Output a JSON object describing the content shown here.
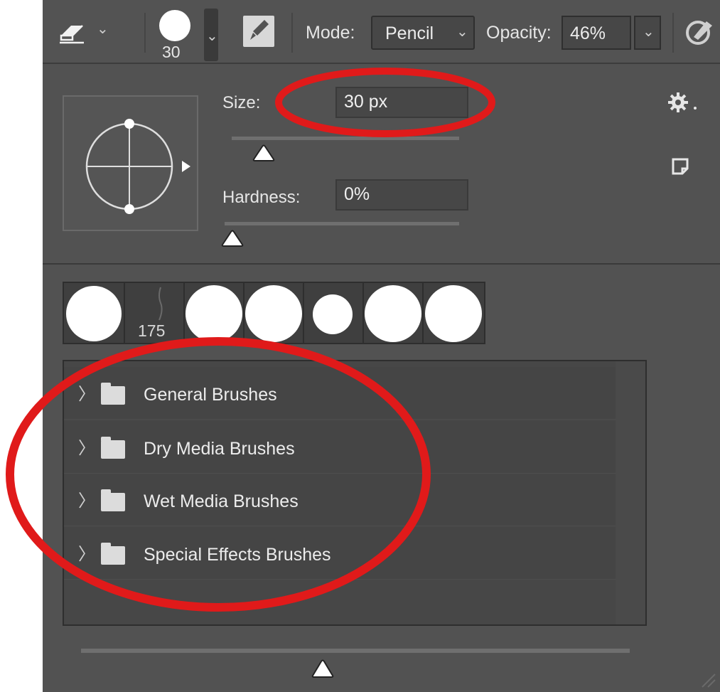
{
  "toolbar": {
    "tool_icon": "eraser-icon",
    "brush_size": "30",
    "mode_label": "Mode:",
    "mode_value": "Pencil",
    "opacity_label": "Opacity:",
    "opacity_value": "46%",
    "airbrush_icon": "airbrush-icon"
  },
  "brush_options": {
    "size_label": "Size:",
    "size_value": "30 px",
    "hardness_label": "Hardness:",
    "hardness_value": "0%",
    "size_slider_level_percent": 14,
    "hardness_slider_level_percent": 0,
    "gear_icon": "gear-icon",
    "new_preset_icon": "new-preset-icon"
  },
  "presets": {
    "items": [
      {
        "label": ""
      },
      {
        "label": "175"
      },
      {
        "label": ""
      },
      {
        "label": ""
      },
      {
        "label": ""
      },
      {
        "label": ""
      },
      {
        "label": ""
      }
    ]
  },
  "brush_groups": [
    {
      "label": "General Brushes"
    },
    {
      "label": "Dry Media Brushes"
    },
    {
      "label": "Wet Media Brushes"
    },
    {
      "label": "Special Effects Brushes"
    }
  ],
  "bottom_slider_level_percent": 44,
  "annotation_color": "#e01a1a"
}
